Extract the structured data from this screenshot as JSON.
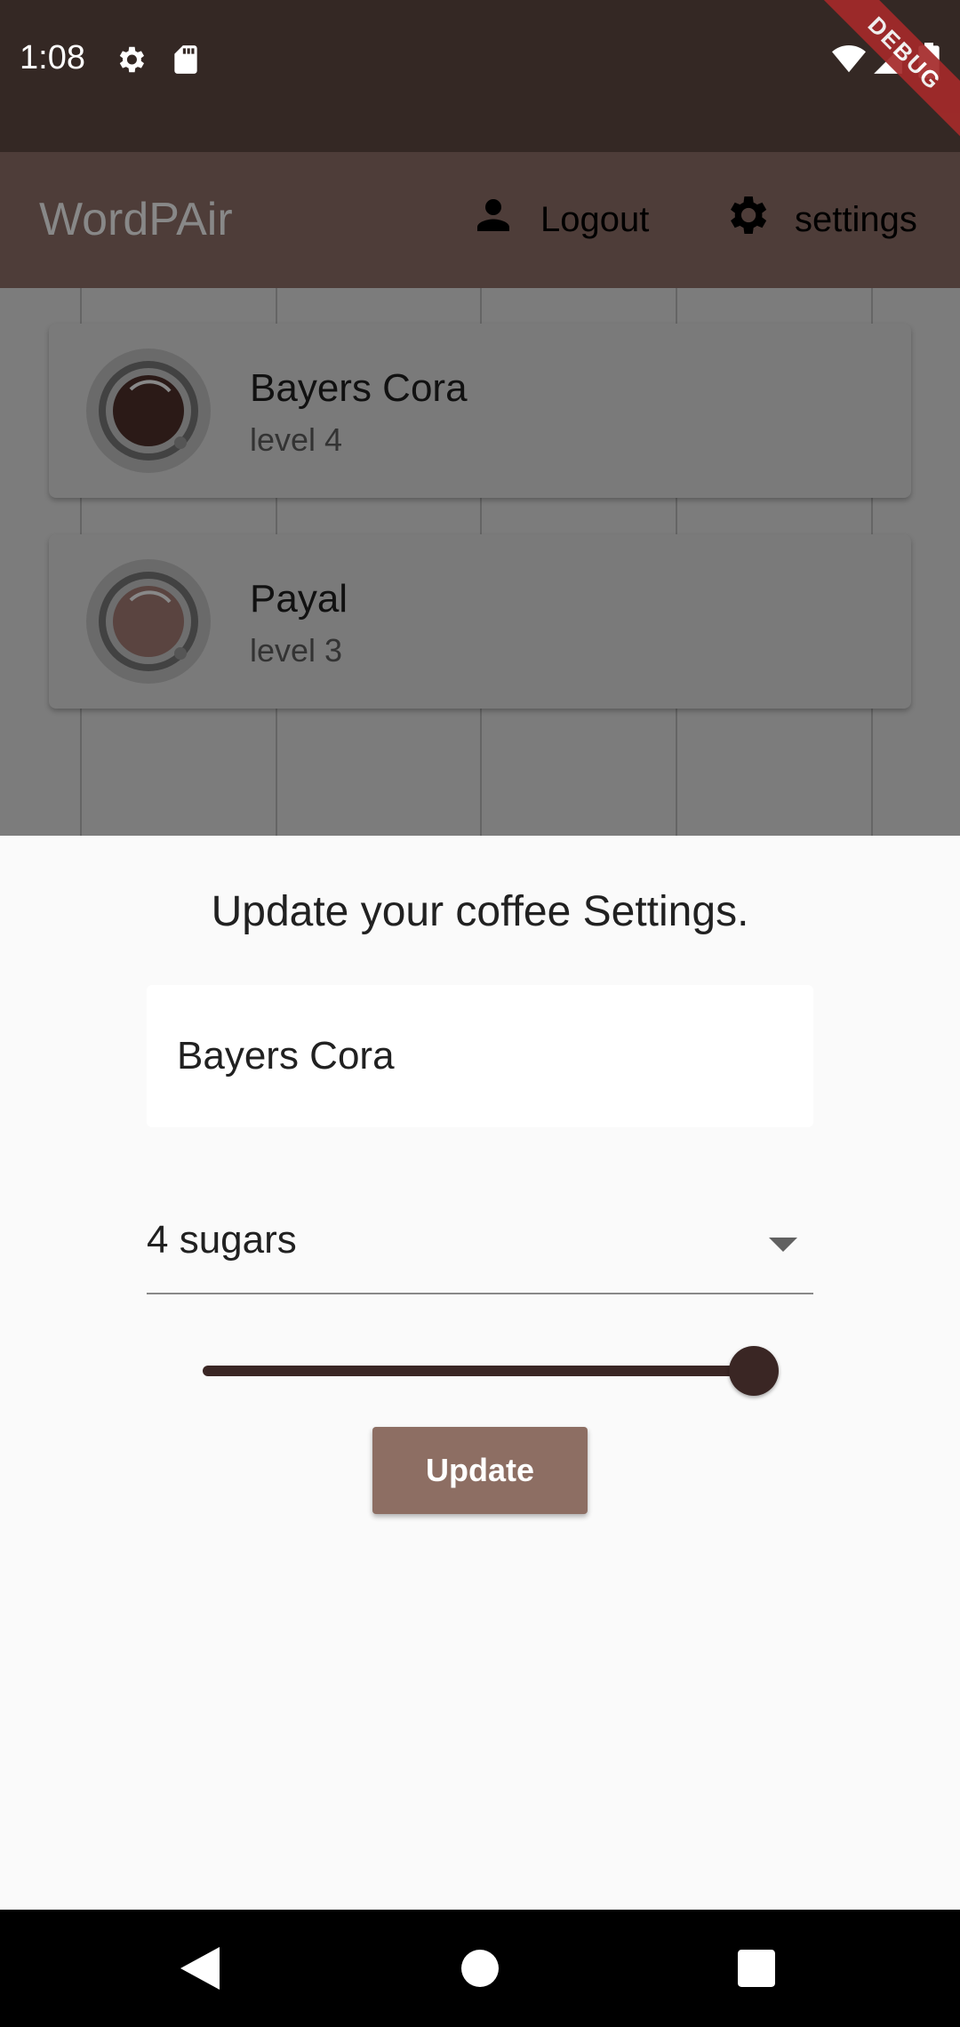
{
  "status_bar": {
    "time": "1:08",
    "icons": [
      "settings-icon",
      "sd-card-icon",
      "wifi-icon",
      "signal-icon",
      "battery-icon"
    ],
    "debug_label": "DEBUG"
  },
  "app_bar": {
    "title": "WordPAir",
    "logout_label": "Logout",
    "settings_label": "settings"
  },
  "list": {
    "items": [
      {
        "name": "Bayers Cora",
        "level": "level 4",
        "coffee_color": "#2b1a17"
      },
      {
        "name": "Payal",
        "level": "level 3",
        "coffee_color": "#5a4440"
      }
    ]
  },
  "sheet": {
    "title": "Update your coffee Settings.",
    "name_value": "Bayers Cora",
    "sugar_value": "4 sugars",
    "strength_fraction": 1.0,
    "update_label": "Update"
  },
  "colors": {
    "status_bar": "#342824",
    "app_bar": "#4e3d39",
    "accent": "#3a2624",
    "button": "#8d6e63"
  }
}
